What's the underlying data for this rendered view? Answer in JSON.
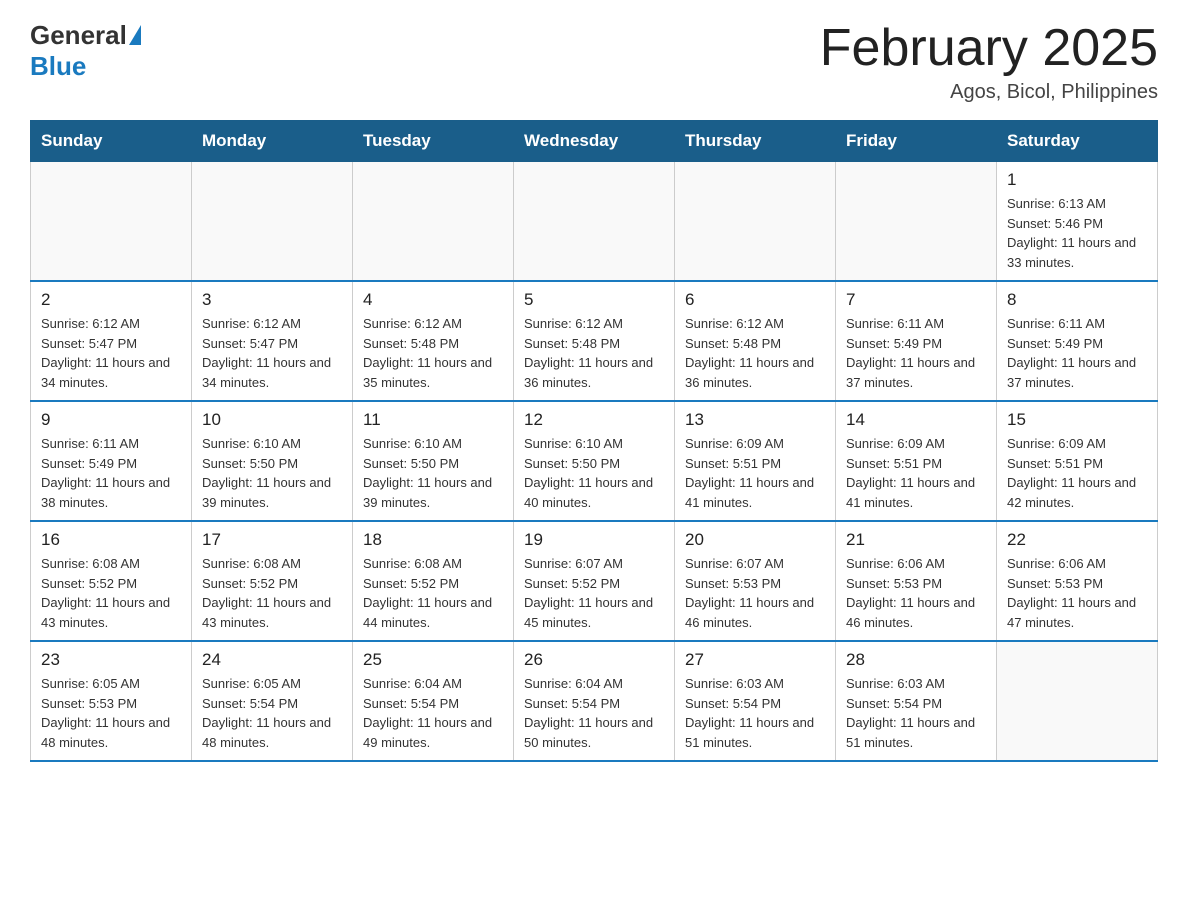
{
  "header": {
    "logo_general": "General",
    "logo_blue": "Blue",
    "title": "February 2025",
    "subtitle": "Agos, Bicol, Philippines"
  },
  "days_of_week": [
    "Sunday",
    "Monday",
    "Tuesday",
    "Wednesday",
    "Thursday",
    "Friday",
    "Saturday"
  ],
  "weeks": [
    [
      {
        "day": "",
        "info": ""
      },
      {
        "day": "",
        "info": ""
      },
      {
        "day": "",
        "info": ""
      },
      {
        "day": "",
        "info": ""
      },
      {
        "day": "",
        "info": ""
      },
      {
        "day": "",
        "info": ""
      },
      {
        "day": "1",
        "info": "Sunrise: 6:13 AM\nSunset: 5:46 PM\nDaylight: 11 hours and 33 minutes."
      }
    ],
    [
      {
        "day": "2",
        "info": "Sunrise: 6:12 AM\nSunset: 5:47 PM\nDaylight: 11 hours and 34 minutes."
      },
      {
        "day": "3",
        "info": "Sunrise: 6:12 AM\nSunset: 5:47 PM\nDaylight: 11 hours and 34 minutes."
      },
      {
        "day": "4",
        "info": "Sunrise: 6:12 AM\nSunset: 5:48 PM\nDaylight: 11 hours and 35 minutes."
      },
      {
        "day": "5",
        "info": "Sunrise: 6:12 AM\nSunset: 5:48 PM\nDaylight: 11 hours and 36 minutes."
      },
      {
        "day": "6",
        "info": "Sunrise: 6:12 AM\nSunset: 5:48 PM\nDaylight: 11 hours and 36 minutes."
      },
      {
        "day": "7",
        "info": "Sunrise: 6:11 AM\nSunset: 5:49 PM\nDaylight: 11 hours and 37 minutes."
      },
      {
        "day": "8",
        "info": "Sunrise: 6:11 AM\nSunset: 5:49 PM\nDaylight: 11 hours and 37 minutes."
      }
    ],
    [
      {
        "day": "9",
        "info": "Sunrise: 6:11 AM\nSunset: 5:49 PM\nDaylight: 11 hours and 38 minutes."
      },
      {
        "day": "10",
        "info": "Sunrise: 6:10 AM\nSunset: 5:50 PM\nDaylight: 11 hours and 39 minutes."
      },
      {
        "day": "11",
        "info": "Sunrise: 6:10 AM\nSunset: 5:50 PM\nDaylight: 11 hours and 39 minutes."
      },
      {
        "day": "12",
        "info": "Sunrise: 6:10 AM\nSunset: 5:50 PM\nDaylight: 11 hours and 40 minutes."
      },
      {
        "day": "13",
        "info": "Sunrise: 6:09 AM\nSunset: 5:51 PM\nDaylight: 11 hours and 41 minutes."
      },
      {
        "day": "14",
        "info": "Sunrise: 6:09 AM\nSunset: 5:51 PM\nDaylight: 11 hours and 41 minutes."
      },
      {
        "day": "15",
        "info": "Sunrise: 6:09 AM\nSunset: 5:51 PM\nDaylight: 11 hours and 42 minutes."
      }
    ],
    [
      {
        "day": "16",
        "info": "Sunrise: 6:08 AM\nSunset: 5:52 PM\nDaylight: 11 hours and 43 minutes."
      },
      {
        "day": "17",
        "info": "Sunrise: 6:08 AM\nSunset: 5:52 PM\nDaylight: 11 hours and 43 minutes."
      },
      {
        "day": "18",
        "info": "Sunrise: 6:08 AM\nSunset: 5:52 PM\nDaylight: 11 hours and 44 minutes."
      },
      {
        "day": "19",
        "info": "Sunrise: 6:07 AM\nSunset: 5:52 PM\nDaylight: 11 hours and 45 minutes."
      },
      {
        "day": "20",
        "info": "Sunrise: 6:07 AM\nSunset: 5:53 PM\nDaylight: 11 hours and 46 minutes."
      },
      {
        "day": "21",
        "info": "Sunrise: 6:06 AM\nSunset: 5:53 PM\nDaylight: 11 hours and 46 minutes."
      },
      {
        "day": "22",
        "info": "Sunrise: 6:06 AM\nSunset: 5:53 PM\nDaylight: 11 hours and 47 minutes."
      }
    ],
    [
      {
        "day": "23",
        "info": "Sunrise: 6:05 AM\nSunset: 5:53 PM\nDaylight: 11 hours and 48 minutes."
      },
      {
        "day": "24",
        "info": "Sunrise: 6:05 AM\nSunset: 5:54 PM\nDaylight: 11 hours and 48 minutes."
      },
      {
        "day": "25",
        "info": "Sunrise: 6:04 AM\nSunset: 5:54 PM\nDaylight: 11 hours and 49 minutes."
      },
      {
        "day": "26",
        "info": "Sunrise: 6:04 AM\nSunset: 5:54 PM\nDaylight: 11 hours and 50 minutes."
      },
      {
        "day": "27",
        "info": "Sunrise: 6:03 AM\nSunset: 5:54 PM\nDaylight: 11 hours and 51 minutes."
      },
      {
        "day": "28",
        "info": "Sunrise: 6:03 AM\nSunset: 5:54 PM\nDaylight: 11 hours and 51 minutes."
      },
      {
        "day": "",
        "info": ""
      }
    ]
  ]
}
